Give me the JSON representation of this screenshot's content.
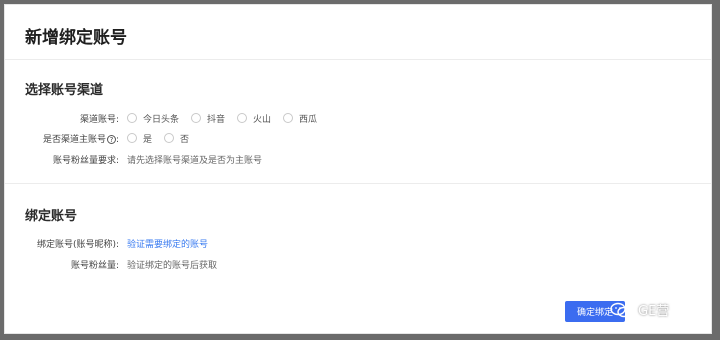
{
  "dialog": {
    "title": "新增绑定账号",
    "section1": {
      "title": "选择账号渠道",
      "channel_label": "渠道账号:",
      "channel_options": [
        "今日头条",
        "抖音",
        "火山",
        "西瓜"
      ],
      "main_account_label": "是否渠道主账号",
      "main_account_label_suffix": ":",
      "help_glyph": "?",
      "main_account_options": [
        "是",
        "否"
      ],
      "fans_requirement_label": "账号粉丝量要求:",
      "fans_requirement_hint": "请先选择账号渠道及是否为主账号"
    },
    "section2": {
      "title": "绑定账号",
      "bind_label": "绑定账号(账号昵称):",
      "bind_link": "验证需要绑定的账号",
      "fans_label": "账号粉丝量:",
      "fans_hint": "验证绑定的账号后获取"
    },
    "confirm_button": "确定绑定"
  },
  "watermark": {
    "text": "GE营",
    "icon": "wechat-logo"
  },
  "colors": {
    "primary": "#3b6cf0",
    "link": "#3a7bf0",
    "backdrop": "#6b6b6b"
  }
}
